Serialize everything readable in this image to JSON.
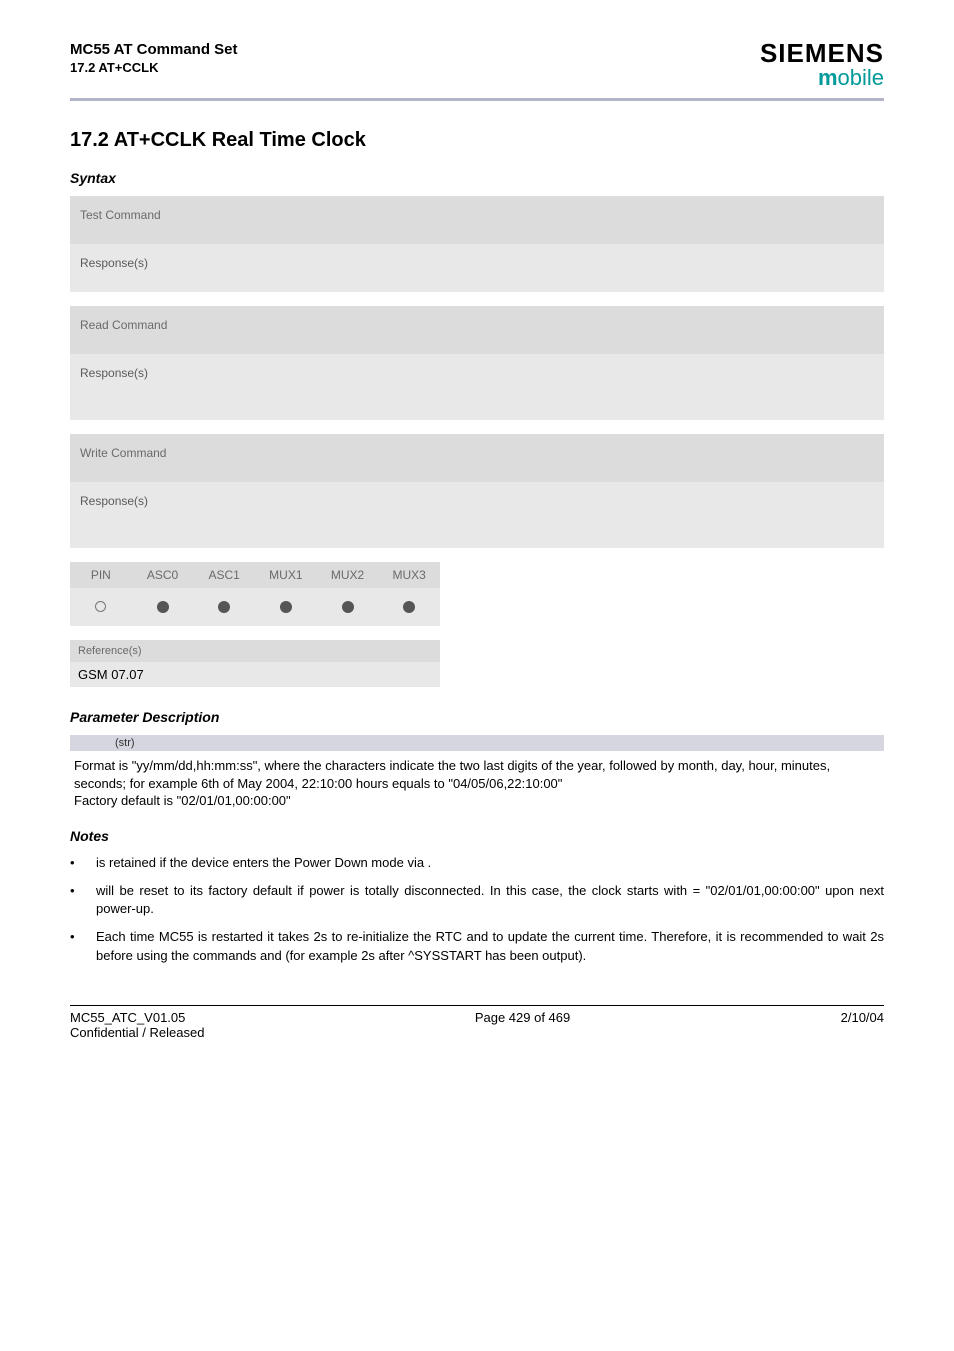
{
  "header": {
    "title_line1": "MC55 AT Command Set",
    "title_line2": "17.2 AT+CCLK",
    "brand": "SIEMENS",
    "brand_sub_m": "m",
    "brand_sub_rest": "obile"
  },
  "section": {
    "number_title": "17.2     AT+CCLK   Real Time Clock",
    "syntax_label": "Syntax"
  },
  "blocks": {
    "test_command": "Test Command",
    "responses": "Response(s)",
    "read_command": "Read Command",
    "write_command": "Write Command"
  },
  "matrix": {
    "cols": [
      "PIN",
      "ASC0",
      "ASC1",
      "MUX1",
      "MUX2",
      "MUX3"
    ],
    "values": [
      "open",
      "filled",
      "filled",
      "filled",
      "filled",
      "filled"
    ]
  },
  "reference": {
    "label": "Reference(s)",
    "value": "GSM 07.07"
  },
  "param": {
    "heading": "Parameter Description",
    "type_label": "(str)",
    "text1": "Format is \"yy/mm/dd,hh:mm:ss\", where the characters indicate the two last digits of the year, followed by month, day, hour, minutes, seconds; for example 6th of May 2004, 22:10:00 hours equals to \"04/05/06,22:10:00\"",
    "text2": "Factory default is \"02/01/01,00:00:00\""
  },
  "notes": {
    "heading": "Notes",
    "items": [
      " is retained if the device enters the Power Down mode via .",
      " will be reset to its factory default if power is totally disconnected. In this case, the clock starts with  = \"02/01/01,00:00:00\" upon next power-up.",
      "Each time MC55 is restarted it takes 2s to re-initialize the RTC and to update the current time. Therefore, it is recommended to wait 2s before using the commands  and  (for example 2s after ^SYSSTART has been output)."
    ]
  },
  "footer": {
    "left1": "MC55_ATC_V01.05",
    "left2": "Confidential / Released",
    "center": "Page 429 of 469",
    "right": "2/10/04"
  }
}
